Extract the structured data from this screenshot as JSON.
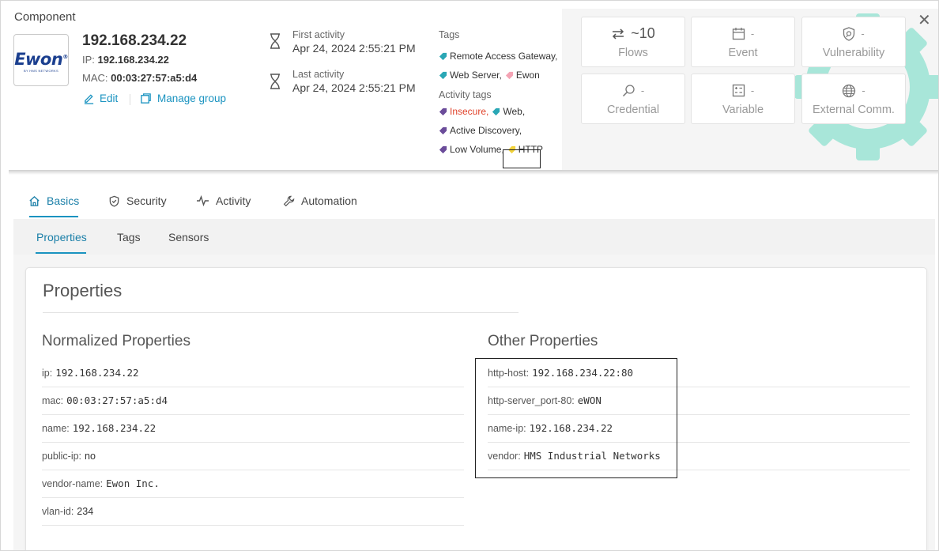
{
  "header": {
    "section_title": "Component",
    "logo_text": "Ewon",
    "logo_subtext": "BY HMS NETWORKS",
    "ip_title": "192.168.234.22",
    "ip_label": "IP:",
    "ip_value": "192.168.234.22",
    "mac_label": "MAC:",
    "mac_value": "00:03:27:57:a5:d4",
    "edit_label": "Edit",
    "manage_group_label": "Manage group"
  },
  "activity": {
    "first_label": "First activity",
    "first_value": "Apr 24, 2024 2:55:21 PM",
    "last_label": "Last activity",
    "last_value": "Apr 24, 2024 2:55:21 PM"
  },
  "tags": {
    "header": "Tags",
    "items": [
      {
        "label": "Remote Access Gateway,",
        "color": "#2aa7b5"
      },
      {
        "label": "Web Server,",
        "color": "#2aa7b5"
      },
      {
        "label": "Ewon",
        "color": "#f4a3b4"
      }
    ],
    "activity_header": "Activity tags",
    "activity_items": [
      {
        "label": "Insecure,",
        "color": "#6b4c9a",
        "text_color": "#e0442c"
      },
      {
        "label": "Web,",
        "color": "#2aa7b5",
        "text_color": "#333333"
      },
      {
        "label": "Active Discovery,",
        "color": "#6b4c9a",
        "text_color": "#333333"
      },
      {
        "label": "Low Volume,",
        "color": "#6b4c9a",
        "text_color": "#333333"
      },
      {
        "label": "HTTP",
        "color": "#f2d33c",
        "text_color": "#333333"
      }
    ]
  },
  "summary_tiles": [
    {
      "icon": "flows-icon",
      "value": "~10",
      "label": "Flows"
    },
    {
      "icon": "calendar-icon",
      "value": "-",
      "label": "Event"
    },
    {
      "icon": "shield-icon",
      "value": "-",
      "label": "Vulnerability"
    },
    {
      "icon": "key-search-icon",
      "value": "-",
      "label": "Credential"
    },
    {
      "icon": "variable-icon",
      "value": "-",
      "label": "Variable"
    },
    {
      "icon": "globe-icon",
      "value": "-",
      "label": "External Comm."
    }
  ],
  "tabs": [
    {
      "label": "Basics",
      "icon": "home-icon",
      "active": true
    },
    {
      "label": "Security",
      "icon": "shield-check-icon",
      "active": false
    },
    {
      "label": "Activity",
      "icon": "pulse-icon",
      "active": false
    },
    {
      "label": "Automation",
      "icon": "wrench-icon",
      "active": false
    }
  ],
  "subtabs": [
    {
      "label": "Properties",
      "active": true
    },
    {
      "label": "Tags",
      "active": false
    },
    {
      "label": "Sensors",
      "active": false
    }
  ],
  "properties": {
    "title": "Properties",
    "normalized_title": "Normalized Properties",
    "normalized": [
      {
        "key": "ip:",
        "value": "192.168.234.22"
      },
      {
        "key": "mac:",
        "value": "00:03:27:57:a5:d4"
      },
      {
        "key": "name:",
        "value": "192.168.234.22"
      },
      {
        "key": "public-ip:",
        "value": "no"
      },
      {
        "key": "vendor-name:",
        "value": "Ewon Inc."
      },
      {
        "key": "vlan-id:",
        "value": "234"
      }
    ],
    "other_title": "Other Properties",
    "other": [
      {
        "key": "http-host:",
        "value": "192.168.234.22:80"
      },
      {
        "key": "http-server_port-80:",
        "value": "eWON"
      },
      {
        "key": "name-ip:",
        "value": "192.168.234.22"
      },
      {
        "key": "vendor:",
        "value": "HMS Industrial Networks"
      }
    ]
  },
  "colors": {
    "accent": "#1a93c0",
    "gear": "#a8e6d9"
  }
}
